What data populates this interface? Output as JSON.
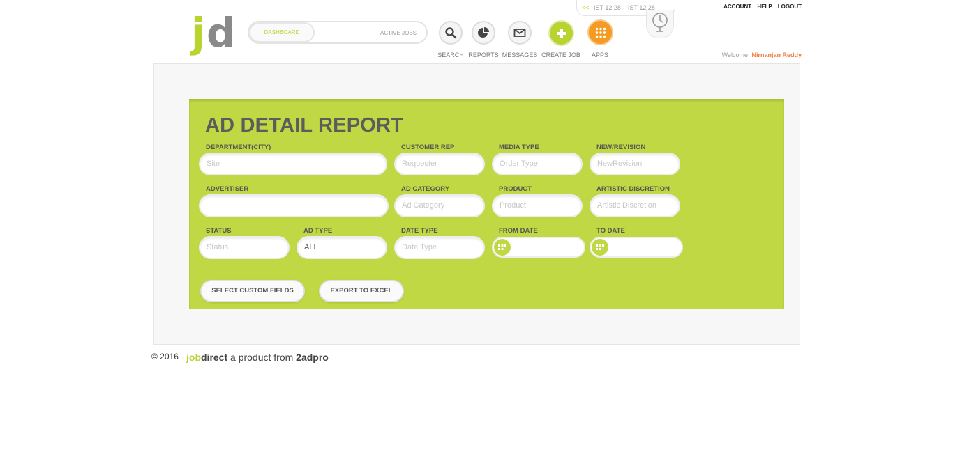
{
  "logo": {
    "j": "j",
    "d": "d"
  },
  "toggle": {
    "dashboard": "DASHBOARD",
    "active_jobs": "ACTIVE JOBS"
  },
  "nav": {
    "search": "SEARCH",
    "reports": "REPORTS",
    "messages": "MESSAGES",
    "create_job": "CREATE JOB",
    "apps": "APPS"
  },
  "clock": {
    "back": "<<",
    "time1": "IST 12:28",
    "time2": "IST 12:28"
  },
  "toplinks": {
    "account": "ACCOUNT",
    "help": "HELP",
    "logout": "LOGOUT"
  },
  "welcome": {
    "label": "Welcome",
    "name": "Nirnanjan Reddy"
  },
  "report": {
    "title": "AD DETAIL REPORT",
    "labels": {
      "department": "DEPARTMENT(CITY)",
      "customer_rep": "CUSTOMER REP",
      "media_type": "MEDIA TYPE",
      "new_revision": "NEW/REVISION",
      "advertiser": "ADVERTISER",
      "ad_category": "AD CATEGORY",
      "product": "PRODUCT",
      "artistic_discretion": "ARTISTIC DISCRETION",
      "status": "STATUS",
      "ad_type": "AD TYPE",
      "date_type": "DATE TYPE",
      "from_date": "FROM DATE",
      "to_date": "TO DATE"
    },
    "placeholders": {
      "department": "Site",
      "customer_rep": "Requester",
      "media_type": "Order Type",
      "new_revision": "NewRevision",
      "advertiser": "",
      "ad_category": "Ad Category",
      "product": "Product",
      "artistic_discretion": "Artistic Discretion",
      "status": "Status",
      "date_type": "Date Type"
    },
    "values": {
      "ad_type": "ALL"
    },
    "buttons": {
      "custom_fields": "SELECT CUSTOM FIELDS",
      "export": "EXPORT TO EXCEL"
    }
  },
  "footer": {
    "copyright": "© 2016",
    "brand_job": "job",
    "brand_direct": "direct",
    "brand_mid": " a product from ",
    "brand_2adpro": "2adpro"
  },
  "colors": {
    "accent_green": "#bfd843",
    "accent_orange": "#f59a23",
    "name_orange": "#f07a3c"
  }
}
